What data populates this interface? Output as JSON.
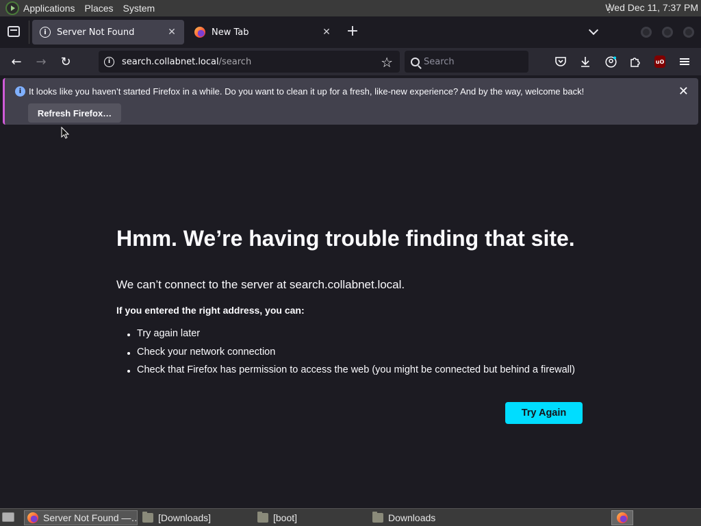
{
  "top_panel": {
    "menus": [
      "Applications",
      "Places",
      "System"
    ],
    "clock": "Wed Dec 11,  7:37 PM"
  },
  "tabs": [
    {
      "title": "Server Not Found",
      "icon": "info-icon",
      "active": true
    },
    {
      "title": "New Tab",
      "icon": "firefox-icon",
      "active": false
    }
  ],
  "nav": {
    "url_host": "search.collabnet.local",
    "url_path": "/search",
    "search_placeholder": "Search"
  },
  "notification": {
    "message": "It looks like you haven’t started Firefox in a while. Do you want to clean it up for a fresh, like-new experience? And by the way, welcome back!",
    "refresh_label": "Refresh Firefox…"
  },
  "error_page": {
    "title": "Hmm. We’re having trouble finding that site.",
    "description": "We can’t connect to the server at search.collabnet.local.",
    "subheading": "If you entered the right address, you can:",
    "suggestions": [
      "Try again later",
      "Check your network connection",
      "Check that Firefox has permission to access the web (you might be connected but behind a firewall)"
    ],
    "try_again_label": "Try Again"
  },
  "taskbar": {
    "items": [
      {
        "label": "Server Not Found —…",
        "icon": "firefox-icon",
        "active": true
      },
      {
        "label": "[Downloads]",
        "icon": "folder-icon",
        "active": false
      },
      {
        "label": "[boot]",
        "icon": "folder-icon",
        "active": false
      },
      {
        "label": "Downloads",
        "icon": "folder-icon",
        "active": false
      }
    ]
  },
  "colors": {
    "accent": "#00ddff",
    "content_bg": "#1c1b22",
    "notification_bg": "#42414d"
  }
}
